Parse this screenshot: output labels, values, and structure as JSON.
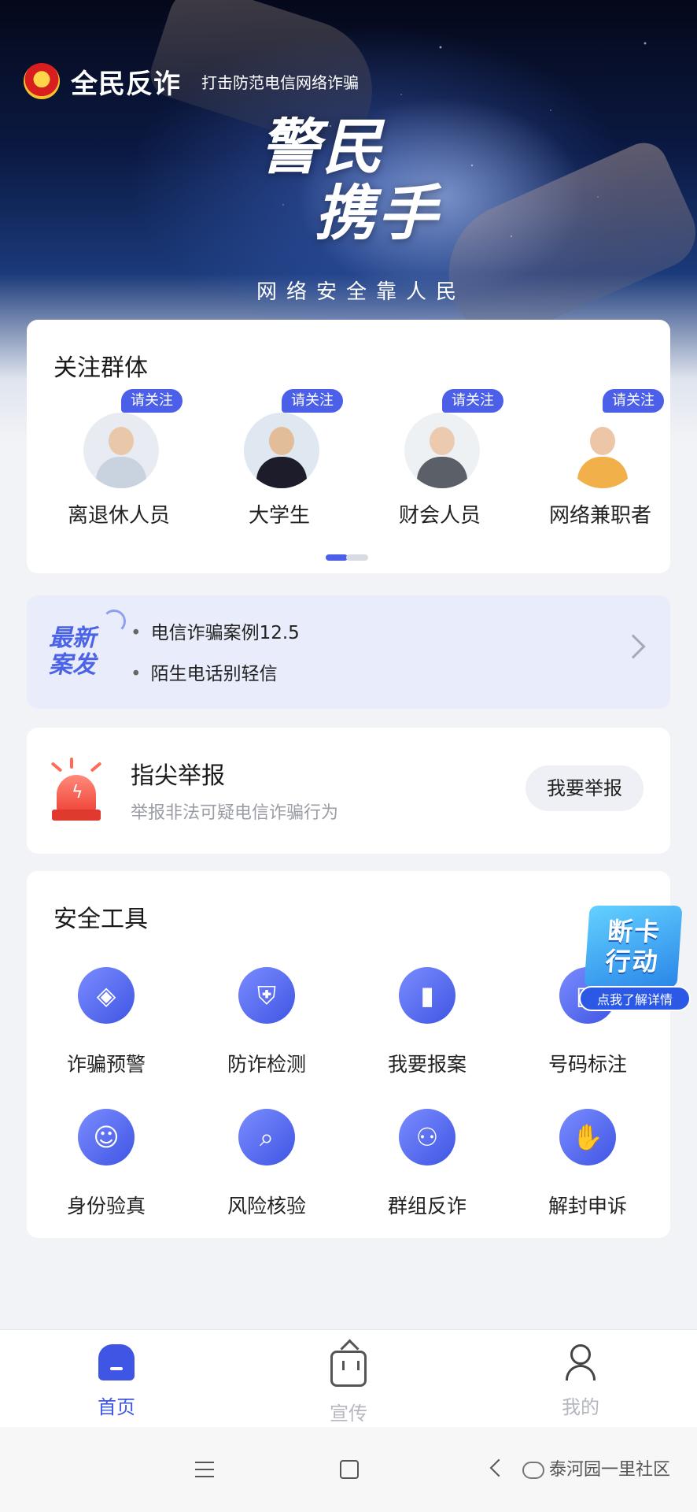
{
  "header": {
    "app_title": "全民反诈",
    "app_subtitle": "打击防范电信网络诈骗",
    "slogan_line1": "警民",
    "slogan_line2": "携手",
    "slogan_sub": "网络安全靠人民"
  },
  "focus_groups": {
    "title": "关注群体",
    "tag": "请关注",
    "items": [
      {
        "label": "离退休人员"
      },
      {
        "label": "大学生"
      },
      {
        "label": "财会人员"
      },
      {
        "label": "网络兼职者"
      }
    ]
  },
  "latest_cases": {
    "badge_line1": "最新",
    "badge_line2": "案发",
    "items": [
      "电信诈骗案例12.5",
      "陌生电话别轻信"
    ]
  },
  "report": {
    "title": "指尖举报",
    "subtitle": "举报非法可疑电信诈骗行为",
    "button": "我要举报"
  },
  "tools": {
    "title": "安全工具",
    "items": [
      {
        "label": "诈骗预警",
        "icon": "layers-icon",
        "glyph": "◈"
      },
      {
        "label": "防诈检测",
        "icon": "shield-icon",
        "glyph": "⛨"
      },
      {
        "label": "我要报案",
        "icon": "report-book-icon",
        "glyph": "▮"
      },
      {
        "label": "号码标注",
        "icon": "number-tag-icon",
        "glyph": "▣"
      },
      {
        "label": "身份验真",
        "icon": "id-verify-icon",
        "glyph": "☺"
      },
      {
        "label": "风险核验",
        "icon": "search-icon",
        "glyph": "⌕"
      },
      {
        "label": "群组反诈",
        "icon": "group-icon",
        "glyph": "⚇"
      },
      {
        "label": "解封申诉",
        "icon": "hand-icon",
        "glyph": "✋"
      }
    ]
  },
  "promo": {
    "line1": "断卡",
    "line2": "行动",
    "pill": "点我了解详情"
  },
  "tabbar": {
    "home": "首页",
    "promotion": "宣传",
    "mine": "我的"
  },
  "watermark": "泰河园一里社区",
  "colors": {
    "accent": "#3f55e3",
    "tag": "#4b5fe8",
    "alarm": "#f0473b",
    "promo": "#2a86e8"
  }
}
